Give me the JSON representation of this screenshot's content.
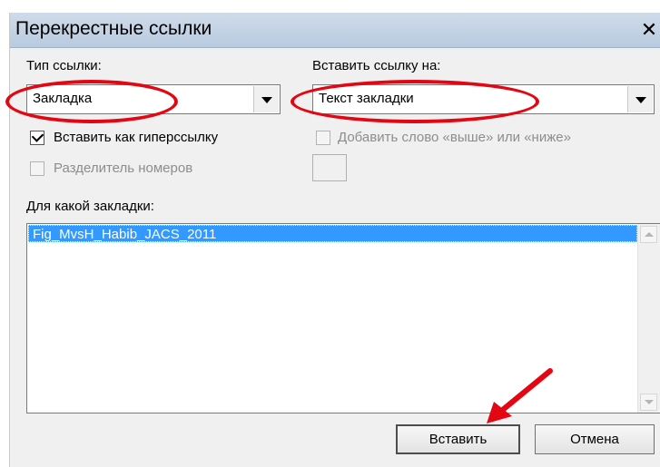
{
  "dialog": {
    "title": "Перекрестные ссылки",
    "close_symbol": "✕"
  },
  "ref_type": {
    "label": "Тип ссылки:",
    "value": "Закладка"
  },
  "insert_ref_to": {
    "label": "Вставить ссылку на:",
    "value": "Текст закладки"
  },
  "options": {
    "hyperlink_label": "Вставить как гиперссылку",
    "hyperlink_checked": true,
    "above_below_label": "Добавить слово «выше» или «ниже»",
    "separator_label": "Разделитель номеров"
  },
  "bookmark_list": {
    "label": "Для какой закладки:",
    "items": [
      "Fig_MvsH_Habib_JACS_2011"
    ]
  },
  "buttons": {
    "insert": "Вставить",
    "cancel": "Отмена"
  },
  "colors": {
    "annotation": "#e30613",
    "selection": "#3399ff"
  },
  "icons": {
    "close": "close-icon",
    "dropdown": "chevron-down-icon",
    "scroll_up": "scroll-up-icon",
    "scroll_down": "scroll-down-icon",
    "check": "checkmark-icon",
    "pointer_arrow": "pointer-arrow-icon"
  }
}
